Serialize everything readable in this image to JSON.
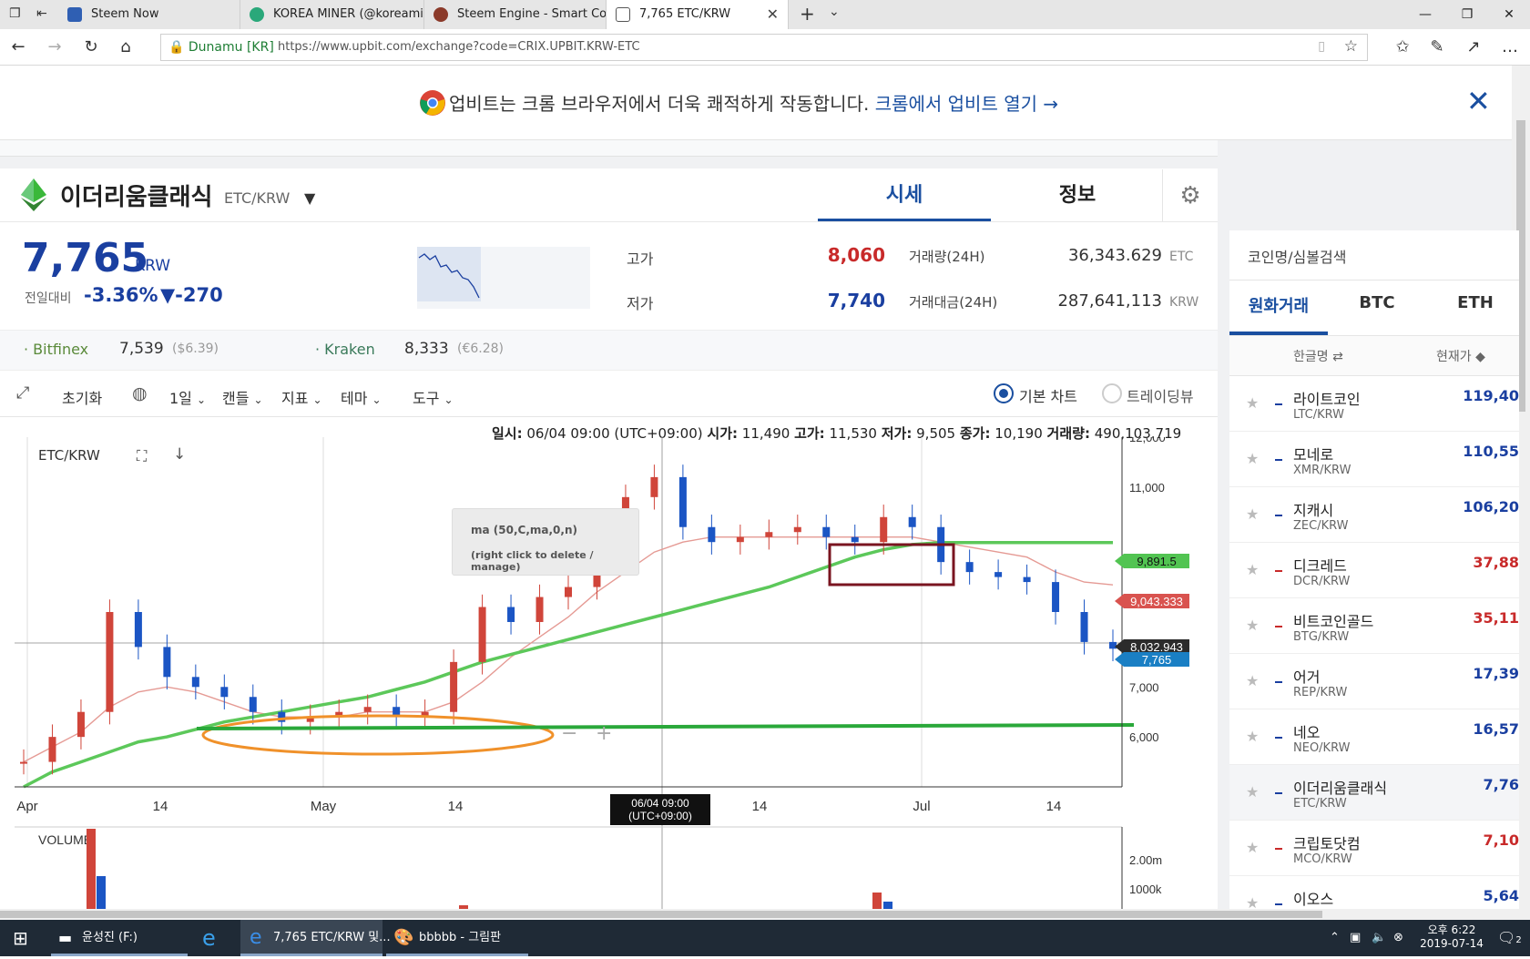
{
  "browser": {
    "tabs": [
      {
        "title": "Steem Now",
        "color": "#2f5fb3"
      },
      {
        "title": "KOREA MINER (@koreamine",
        "color": "#2aa87a"
      },
      {
        "title": "Steem Engine - Smart Contr",
        "color": "#8b3a2a"
      },
      {
        "title": "7,765 ETC/KRW",
        "color": "#555555"
      }
    ],
    "site_identity": "Dunamu [KR]",
    "url": "https://www.upbit.com/exchange?code=CRIX.UPBIT.KRW-ETC"
  },
  "notice": {
    "text": "업비트는 크롬 브라우저에서 더욱 쾌적하게 작동합니다. ",
    "link": "크롬에서 업비트 열기 →"
  },
  "coin_header": {
    "name": "이더리움클래식",
    "pair": "ETC/KRW",
    "tab_price": "시세",
    "tab_info": "정보"
  },
  "ticker": {
    "price": "7,765",
    "currency": "KRW",
    "change_label": "전일대비",
    "change_pct": "-3.36%",
    "change_amt": "▼-270",
    "high_label": "고가",
    "high": "8,060",
    "low_label": "저가",
    "low": "7,740",
    "vol_label": "거래량(24H)",
    "vol": "36,343.629",
    "vol_unit": "ETC",
    "amt_label": "거래대금(24H)",
    "amt": "287,641,113",
    "amt_unit": "KRW"
  },
  "exchanges": [
    {
      "name": "Bitfinex",
      "price": "7,539",
      "alt": "($6.39)"
    },
    {
      "name": "Kraken",
      "price": "8,333",
      "alt": "(€6.28)"
    }
  ],
  "toolbar": {
    "reset": "초기화",
    "interval": "1일",
    "candle": "캔들",
    "indicator": "지표",
    "theme": "테마",
    "tools": "도구",
    "basic_chart": "기본 차트",
    "tradingview": "트레이딩뷰"
  },
  "chart_info": {
    "date_label": "일시:",
    "date": "06/04 09:00 (UTC+09:00)",
    "open_label": "시가:",
    "open": "11,490",
    "high_label": "고가:",
    "high": "11,530",
    "low_label": "저가:",
    "low": "9,505",
    "close_label": "종가:",
    "close": "10,190",
    "volume_label": "거래량:",
    "volume": "490,103.719"
  },
  "tooltip": {
    "line1": "ma (50,C,ma,0,n)",
    "line2": "(right click to delete / manage)"
  },
  "chart_data": {
    "type": "line",
    "title": "ETC/KRW",
    "ylim": [
      5000,
      12000
    ],
    "yticks": [
      "12,000",
      "11,000",
      "9,891.5",
      "9,043.333",
      "8,032.943",
      "7,765",
      "7,000",
      "6,000"
    ],
    "xticks": [
      "Apr",
      "14",
      "May",
      "14",
      "06/04 09:00\n(UTC+09:00)",
      "14",
      "Jul",
      "14"
    ],
    "xtick_cursor": [
      "06/04 09:00",
      "(UTC+09:00)"
    ],
    "series": [
      {
        "name": "price",
        "color": "#c0504d",
        "values": [
          5500,
          6000,
          6500,
          8500,
          7800,
          7200,
          7000,
          6800,
          6500,
          6300,
          6400,
          6500,
          6600,
          6400,
          6500,
          7500,
          8600,
          8300,
          8800,
          9000,
          9500,
          10800,
          11200,
          10200,
          9900,
          10000,
          10100,
          10200,
          10000,
          9900,
          10400,
          10200,
          9500,
          9300,
          9200,
          9100,
          8500,
          7900,
          7765
        ]
      },
      {
        "name": "ma-short",
        "color": "#e59a94",
        "values": [
          5500,
          5800,
          6100,
          6600,
          6900,
          7000,
          6900,
          6700,
          6500,
          6400,
          6400,
          6400,
          6500,
          6500,
          6500,
          6700,
          7100,
          7600,
          8000,
          8400,
          8900,
          9300,
          9700,
          9900,
          10000,
          10000,
          10000,
          10000,
          10000,
          10000,
          10000,
          10000,
          9900,
          9800,
          9700,
          9600,
          9300,
          9100,
          9043
        ]
      },
      {
        "name": "ma (50,C,ma,0,n)",
        "color": "#5cc85a",
        "values": [
          5000,
          5300,
          5500,
          5700,
          5900,
          6000,
          6150,
          6300,
          6400,
          6500,
          6600,
          6700,
          6800,
          6950,
          7100,
          7300,
          7500,
          7650,
          7800,
          7950,
          8100,
          8250,
          8400,
          8550,
          8700,
          8850,
          9000,
          9200,
          9400,
          9600,
          9750,
          9850,
          9891,
          9891,
          9891,
          9891,
          9891,
          9891,
          9891
        ]
      }
    ],
    "overlay_labels": {
      "ma_green": "9,891.5",
      "ma_red": "9,043.333",
      "crosshair": "8,032.943",
      "last": "7,765"
    },
    "volume_label": "VOLUME",
    "volume_ticks": [
      "2.00m",
      "1000k"
    ]
  },
  "right_panel": {
    "search_placeholder": "코인명/심볼검색",
    "tabs": [
      "원화거래",
      "BTC",
      "ETH"
    ],
    "col_name": "한글명 ⇄",
    "col_price": "현재가 ◆",
    "coins": [
      {
        "name": "라이트코인",
        "symbol": "LTC/KRW",
        "price": "119,40",
        "color": "#1a3fa0"
      },
      {
        "name": "모네로",
        "symbol": "XMR/KRW",
        "price": "110,55",
        "color": "#1a3fa0"
      },
      {
        "name": "지캐시",
        "symbol": "ZEC/KRW",
        "price": "106,20",
        "color": "#1a3fa0"
      },
      {
        "name": "디크레드",
        "symbol": "DCR/KRW",
        "price": "37,88",
        "color": "#c82a2a"
      },
      {
        "name": "비트코인골드",
        "symbol": "BTG/KRW",
        "price": "35,11",
        "color": "#c82a2a"
      },
      {
        "name": "어거",
        "symbol": "REP/KRW",
        "price": "17,39",
        "color": "#1a3fa0"
      },
      {
        "name": "네오",
        "symbol": "NEO/KRW",
        "price": "16,57",
        "color": "#1a3fa0"
      },
      {
        "name": "이더리움클래식",
        "symbol": "ETC/KRW",
        "price": "7,76",
        "color": "#1a3fa0"
      },
      {
        "name": "크립토닷컴",
        "symbol": "MCO/KRW",
        "price": "7,10",
        "color": "#c82a2a"
      },
      {
        "name": "이오스",
        "symbol": "",
        "price": "5,64",
        "color": "#1a3fa0"
      }
    ]
  },
  "taskbar": {
    "items": [
      "윤성진 (F:)",
      "7,765 ETC/KRW 및...",
      "bbbbb - 그림판"
    ],
    "time": "오후 6:22",
    "date": "2019-07-14",
    "notif_count": "2"
  }
}
